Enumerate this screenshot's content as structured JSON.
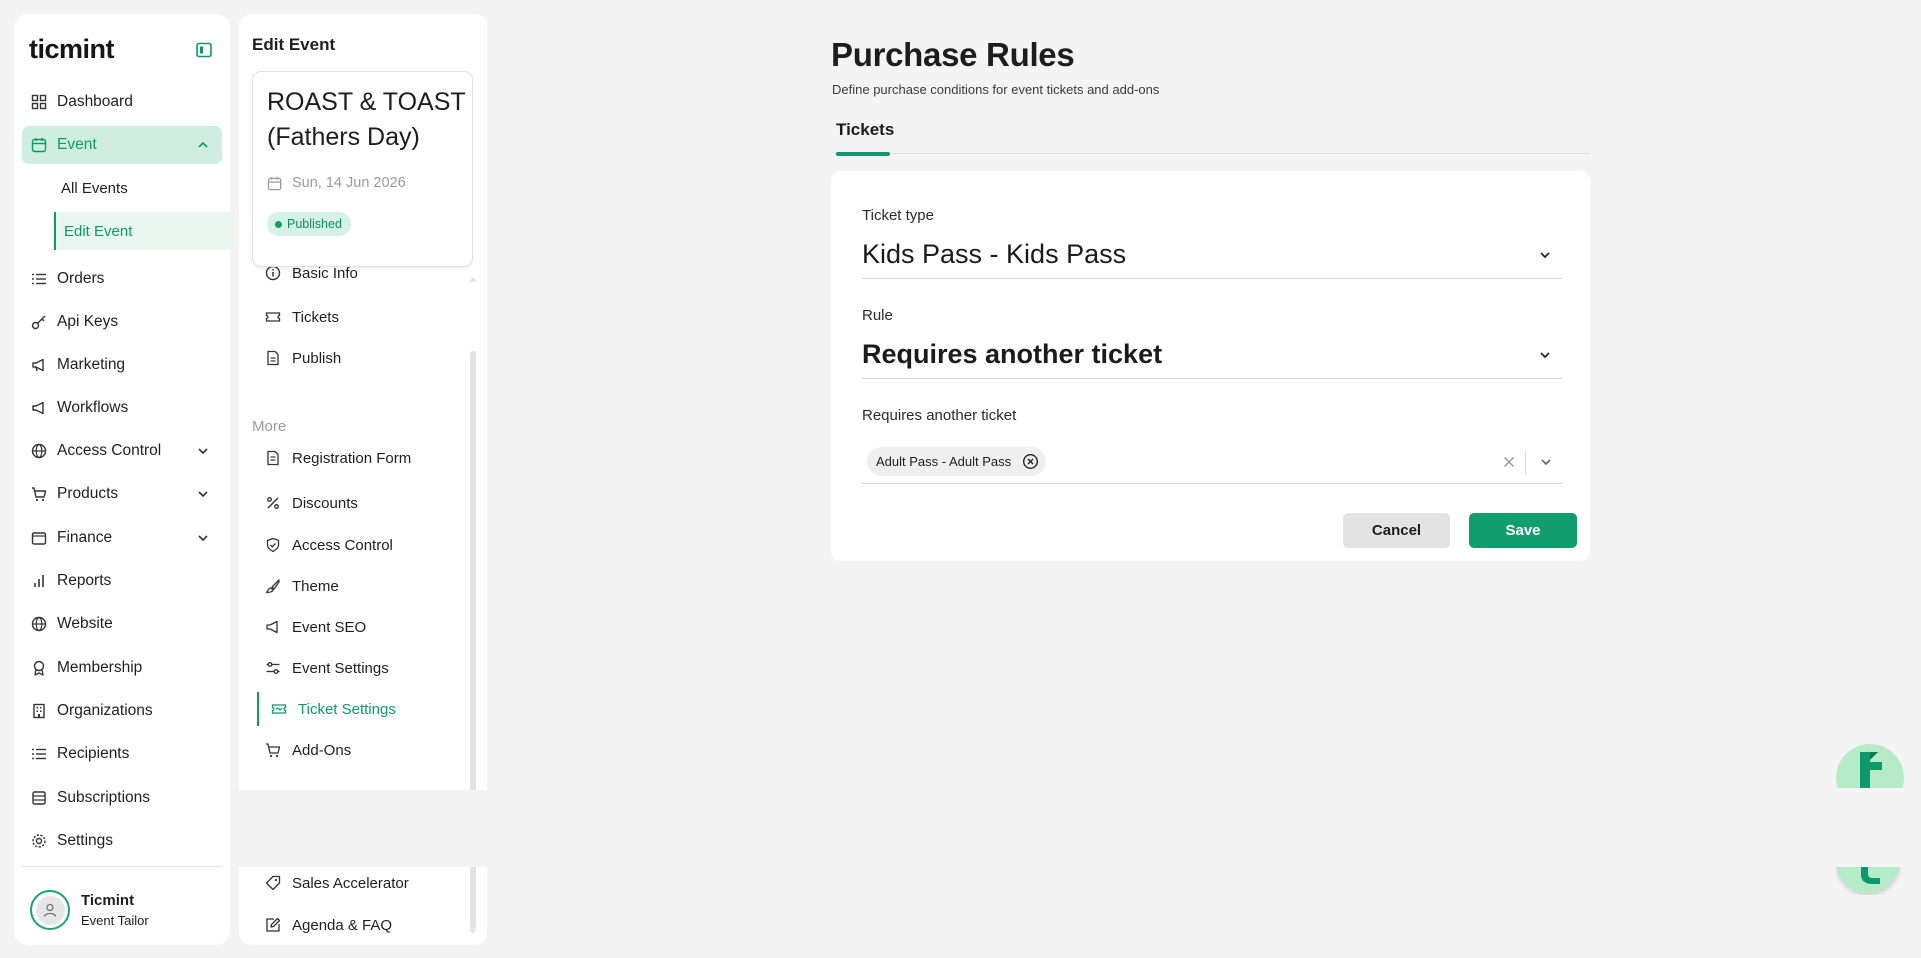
{
  "brand": {
    "logo": "ticmint",
    "accent_color": "#0a9a6c"
  },
  "sidebar": {
    "items": [
      {
        "label": "Dashboard",
        "icon": "dashboard-icon"
      },
      {
        "label": "Event",
        "icon": "calendar-icon"
      },
      {
        "label": "Orders",
        "icon": "list-icon"
      },
      {
        "label": "Api Keys",
        "icon": "key-icon"
      },
      {
        "label": "Marketing",
        "icon": "megaphone-icon"
      },
      {
        "label": "Workflows",
        "icon": "workflow-icon"
      },
      {
        "label": "Access Control",
        "icon": "globe-lock-icon"
      },
      {
        "label": "Products",
        "icon": "cart-icon"
      },
      {
        "label": "Finance",
        "icon": "wallet-icon"
      },
      {
        "label": "Reports",
        "icon": "bar-chart-icon"
      },
      {
        "label": "Website",
        "icon": "globe-icon"
      },
      {
        "label": "Membership",
        "icon": "award-icon"
      },
      {
        "label": "Organizations",
        "icon": "building-icon"
      },
      {
        "label": "Recipients",
        "icon": "list-icon"
      },
      {
        "label": "Subscriptions",
        "icon": "box-icon"
      },
      {
        "label": "Settings",
        "icon": "gear-icon"
      }
    ],
    "event_sub_items": [
      "All Events",
      "Edit Event"
    ],
    "user": {
      "name": "Ticmint",
      "role": "Event Tailor"
    }
  },
  "edit_panel": {
    "title": "Edit Event",
    "event": {
      "name": "ROAST & TOAST (Fathers Day)",
      "date": "Sun, 14 Jun 2026",
      "status": "Published"
    },
    "items": [
      {
        "label": "Basic Info",
        "icon": "info-icon"
      },
      {
        "label": "Tickets",
        "icon": "ticket-icon"
      },
      {
        "label": "Publish",
        "icon": "document-icon"
      }
    ],
    "more_label": "More",
    "more_items": [
      {
        "label": "Registration Form",
        "icon": "form-icon"
      },
      {
        "label": "Discounts",
        "icon": "percent-icon"
      },
      {
        "label": "Access Control",
        "icon": "shield-icon"
      },
      {
        "label": "Theme",
        "icon": "paint-brush-icon"
      },
      {
        "label": "Event SEO",
        "icon": "megaphone-icon"
      },
      {
        "label": "Event Settings",
        "icon": "sliders-icon"
      },
      {
        "label": "Ticket Settings",
        "icon": "ticket-settings-icon"
      },
      {
        "label": "Add-Ons",
        "icon": "cart-icon"
      },
      {
        "label": "Sales Accelerator",
        "icon": "tag-icon"
      },
      {
        "label": "Agenda & FAQ",
        "icon": "edit-icon"
      }
    ]
  },
  "main": {
    "title": "Purchase Rules",
    "subtitle": "Define purchase conditions for event tickets and add-ons",
    "tabs": [
      {
        "label": "Tickets",
        "active": true
      }
    ],
    "form": {
      "ticket_type_label": "Ticket type",
      "ticket_type_value": "Kids Pass - Kids Pass",
      "rule_label": "Rule",
      "rule_value": "Requires another ticket",
      "requires_label": "Requires another ticket",
      "requires_selected": [
        "Adult Pass - Adult Pass"
      ],
      "cancel_label": "Cancel",
      "save_label": "Save"
    }
  }
}
